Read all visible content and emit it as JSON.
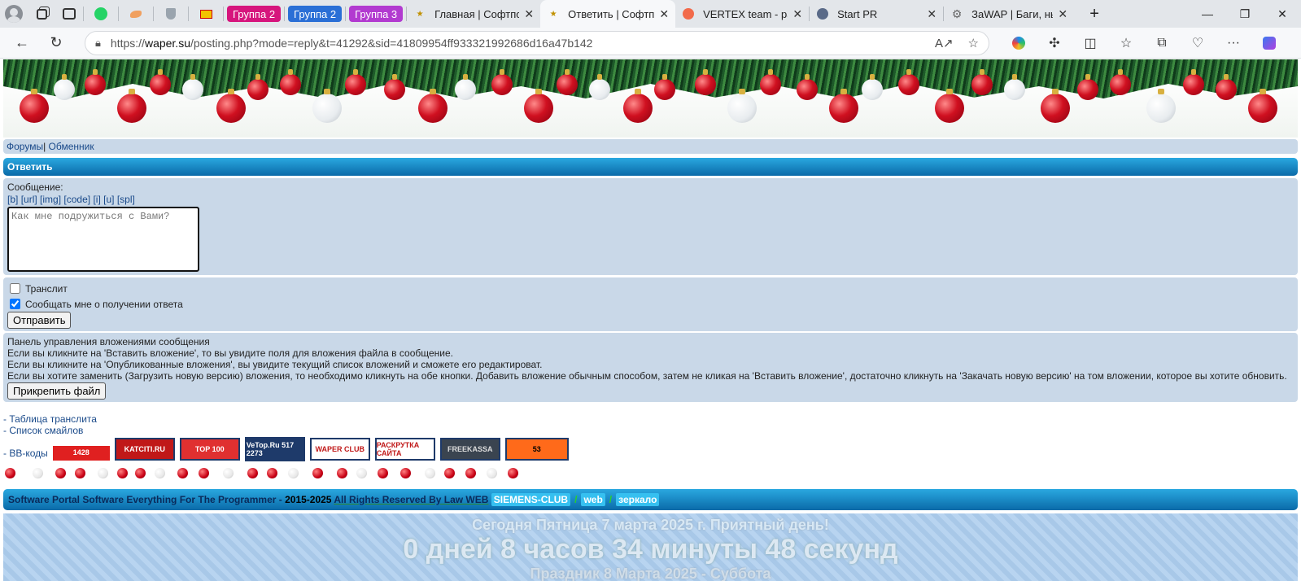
{
  "browser": {
    "tabs": [
      {
        "label": "Группа 2",
        "type": "group",
        "color": "#d6157d"
      },
      {
        "label": "Группа 2",
        "type": "group",
        "color": "#2a6fd6"
      },
      {
        "label": "Группа 3",
        "type": "group",
        "color": "#b23ad0"
      },
      {
        "label": "Главная | Софтпор",
        "type": "tab"
      },
      {
        "label": "Ответить | Софтпор",
        "type": "tab",
        "active": true
      },
      {
        "label": "VERTEX team - разр",
        "type": "tab"
      },
      {
        "label": "Start PR",
        "type": "tab"
      },
      {
        "label": "ЗаWAP | Баги, ньан",
        "type": "tab"
      }
    ],
    "url_prefix": "https://",
    "url_domain": "waper.su",
    "url_path": "/posting.php?mode=reply&t=41292&sid=41809954ff933321992686d16a47b142"
  },
  "nav": {
    "forums": "Форумы",
    "sep": "|",
    "exchange": "Обменник"
  },
  "reply_header": "Ответить",
  "message": {
    "label": "Сообщение:",
    "bbcodes": [
      "[b]",
      "[url]",
      "[img]",
      "[code]",
      "[i]",
      "[u]",
      "[spl]"
    ],
    "placeholder": "Как мне подружиться с Вами?"
  },
  "options": {
    "translit": {
      "label": "Транслит",
      "checked": false
    },
    "notify": {
      "label": "Сообщать мне о получении ответа",
      "checked": true
    },
    "submit": "Отправить"
  },
  "attachments": {
    "title": "Панель управления вложениями сообщения",
    "line1": "Если вы кликните на 'Вставить вложение', то вы увидите поля для вложения файла в сообщение.",
    "line2": "Если вы кликните на 'Опубликованные вложения', вы увидите текущий список вложений и сможете его редактироват.",
    "line3": "Если вы хотите заменить (Загрузить новую версию) вложения, то необходимо кликнуть на обе кнопки. Добавить вложение обычным способом, затем не кликая на 'Вставить вложение', достаточно кликнуть на 'Закачать новую версию' на том вложении, которое вы хотите обновить.",
    "button": "Прикрепить файл"
  },
  "links": {
    "translit_table": "- Таблица транслита",
    "smiles": "- Список смайлов",
    "bbcodes": "- ВВ-коды"
  },
  "counters": [
    {
      "text": "1428",
      "bg": "#e02020"
    },
    {
      "text": "KATCITI.RU",
      "bg": "#c01818"
    },
    {
      "text": "TOP 100",
      "bg": "#e03030"
    },
    {
      "text": "VeTop.Ru 517 2273",
      "bg": "#1e3a6a"
    },
    {
      "text": "WAPER CLUB",
      "bg": "#ffffff"
    },
    {
      "text": "РАСКРУТКА САЙТА",
      "bg": "#ffffff"
    },
    {
      "text": "FREEKASSA",
      "bg": "#3a4450"
    },
    {
      "text": "53",
      "bg": "#ff6a1a"
    }
  ],
  "footer": {
    "text1": "Software Portal Software Everything For The Programmer -",
    "years": "2015-2025",
    "rights": "All Rights Reserved By Law WEB",
    "siemens": "SIEMENS-CLUB",
    "slash": "/",
    "web": "web",
    "mirror": "зеркало"
  },
  "clock": {
    "today": "Сегодня Пятница 7 марта 2025 г. Приятный день!",
    "countdown": "0 дней 8 часов 34 минуты 48 секунд",
    "holiday": "Праздник 8 Марта 2025 - Суббота"
  }
}
